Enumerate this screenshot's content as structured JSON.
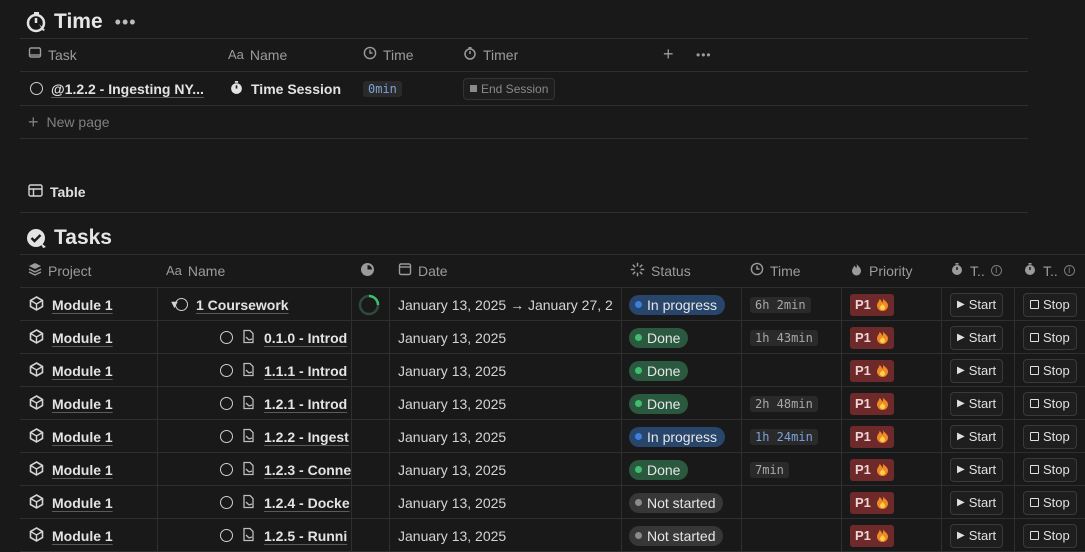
{
  "time_section": {
    "title": "Time",
    "columns": {
      "task": "Task",
      "name": "Name",
      "name_prefix": "Aa",
      "time": "Time",
      "timer": "Timer"
    },
    "row": {
      "task": "@1.2.2 - Ingesting NY...",
      "name": "Time Session",
      "time": "0min",
      "timer_button": "End Session"
    },
    "new_page": "New page"
  },
  "table_view": {
    "label": "Table"
  },
  "tasks_section": {
    "title": "Tasks",
    "columns": {
      "project": "Project",
      "name_prefix": "Aa",
      "name": "Name",
      "date": "Date",
      "status": "Status",
      "time": "Time",
      "priority": "Priority",
      "start_col": "T..",
      "stop_col": "T.."
    },
    "start_label": "Start",
    "stop_label": "Stop",
    "rows": [
      {
        "project": "Module 1",
        "name": "1 Coursework",
        "date": "January 13, 2025 → January 27, 2",
        "status": "In progress",
        "time": "6h 2min",
        "priority": "P1"
      },
      {
        "project": "Module 1",
        "name": "0.1.0 - Introd",
        "date": "January 13, 2025",
        "status": "Done",
        "time": "1h 43min",
        "priority": "P1"
      },
      {
        "project": "Module 1",
        "name": "1.1.1 - Introd",
        "date": "January 13, 2025",
        "status": "Done",
        "time": "",
        "priority": "P1"
      },
      {
        "project": "Module 1",
        "name": "1.2.1 - Introd",
        "date": "January 13, 2025",
        "status": "Done",
        "time": "2h 48min",
        "priority": "P1"
      },
      {
        "project": "Module 1",
        "name": "1.2.2 - Ingest",
        "date": "January 13, 2025",
        "status": "In progress",
        "time": "1h 24min",
        "priority": "P1"
      },
      {
        "project": "Module 1",
        "name": "1.2.3 - Conne",
        "date": "January 13, 2025",
        "status": "Done",
        "time": "7min",
        "priority": "P1"
      },
      {
        "project": "Module 1",
        "name": "1.2.4 - Docke",
        "date": "January 13, 2025",
        "status": "Not started",
        "time": "",
        "priority": "P1"
      },
      {
        "project": "Module 1",
        "name": "1.2.5 - Runni",
        "date": "January 13, 2025",
        "status": "Not started",
        "time": "",
        "priority": "P1"
      }
    ]
  },
  "colors": {
    "in_progress_bg": "#28456c",
    "in_progress_dot": "#3a7ee0",
    "done_bg": "#2b593f",
    "done_dot": "#3fbf6d",
    "not_started_bg": "#373737",
    "not_started_dot": "#8a8a8a",
    "priority_bg": "#6e2a2a"
  }
}
